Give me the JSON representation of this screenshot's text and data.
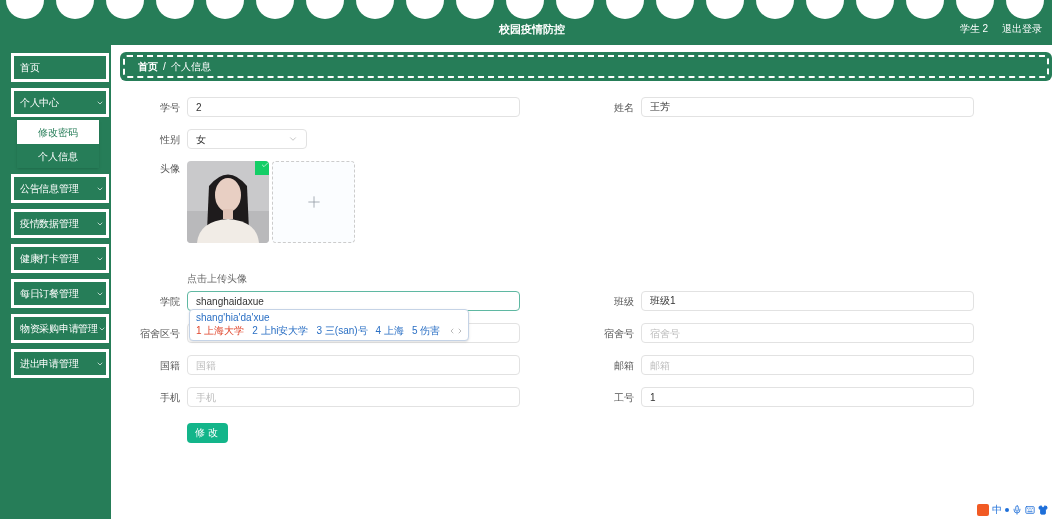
{
  "header": {
    "title": "校园疫情防控",
    "user": "学生 2",
    "logout": "退出登录"
  },
  "sidebar": {
    "items": [
      {
        "label": "首页",
        "expandable": false
      },
      {
        "label": "个人中心",
        "expandable": true,
        "expanded": true,
        "children": [
          {
            "label": "修改密码",
            "selected": true
          },
          {
            "label": "个人信息",
            "selected": false
          }
        ]
      },
      {
        "label": "公告信息管理",
        "expandable": true
      },
      {
        "label": "疫情数据管理",
        "expandable": true
      },
      {
        "label": "健康打卡管理",
        "expandable": true
      },
      {
        "label": "每日订餐管理",
        "expandable": true
      },
      {
        "label": "物资采购申请管理",
        "expandable": true
      },
      {
        "label": "进出申请管理",
        "expandable": true
      }
    ]
  },
  "breadcrumb": {
    "items": [
      "首页",
      "个人信息"
    ],
    "separator": "/"
  },
  "form": {
    "rows": [
      [
        {
          "kind": "input",
          "label": "学号",
          "value": "2",
          "focused": false
        },
        {
          "kind": "input",
          "label": "姓名",
          "value": "王芳",
          "focused": false
        }
      ],
      [
        {
          "kind": "select",
          "label": "性别",
          "value": "女"
        }
      ],
      [
        {
          "kind": "avatar",
          "label": "头像",
          "uploaded": true
        }
      ],
      [
        {
          "kind": "hint",
          "text": "点击上传头像"
        }
      ],
      [
        {
          "kind": "input",
          "label": "学院",
          "value": "shanghaidaxue",
          "focused": true
        },
        {
          "kind": "input",
          "label": "班级",
          "value": "班级1",
          "focused": false
        }
      ],
      [
        {
          "kind": "input",
          "label": "宿舍区号",
          "focused": false
        },
        {
          "kind": "input",
          "label": "宿舍号",
          "placeholder": "宿舍号",
          "focused": false
        }
      ],
      [
        {
          "kind": "input",
          "label": "国籍",
          "placeholder": "国籍",
          "focused": false
        },
        {
          "kind": "input",
          "label": "邮箱",
          "placeholder": "邮箱",
          "focused": false
        }
      ],
      [
        {
          "kind": "input",
          "label": "手机",
          "placeholder": "手机",
          "focused": false
        },
        {
          "kind": "input",
          "label": "工号",
          "value": "1",
          "focused": false
        }
      ]
    ],
    "submit": "修改"
  },
  "ime": {
    "pinyin": "shang'hia'da'xue",
    "candidates": [
      {
        "text": "1 上海大学",
        "selected": true
      },
      {
        "text": "2 上hi安大学",
        "selected": false
      },
      {
        "text": "3 三(san)号",
        "selected": false
      },
      {
        "text": "4 上海",
        "selected": false
      },
      {
        "text": "5 伤害",
        "selected": false
      }
    ],
    "toolbar_mode": "中"
  }
}
